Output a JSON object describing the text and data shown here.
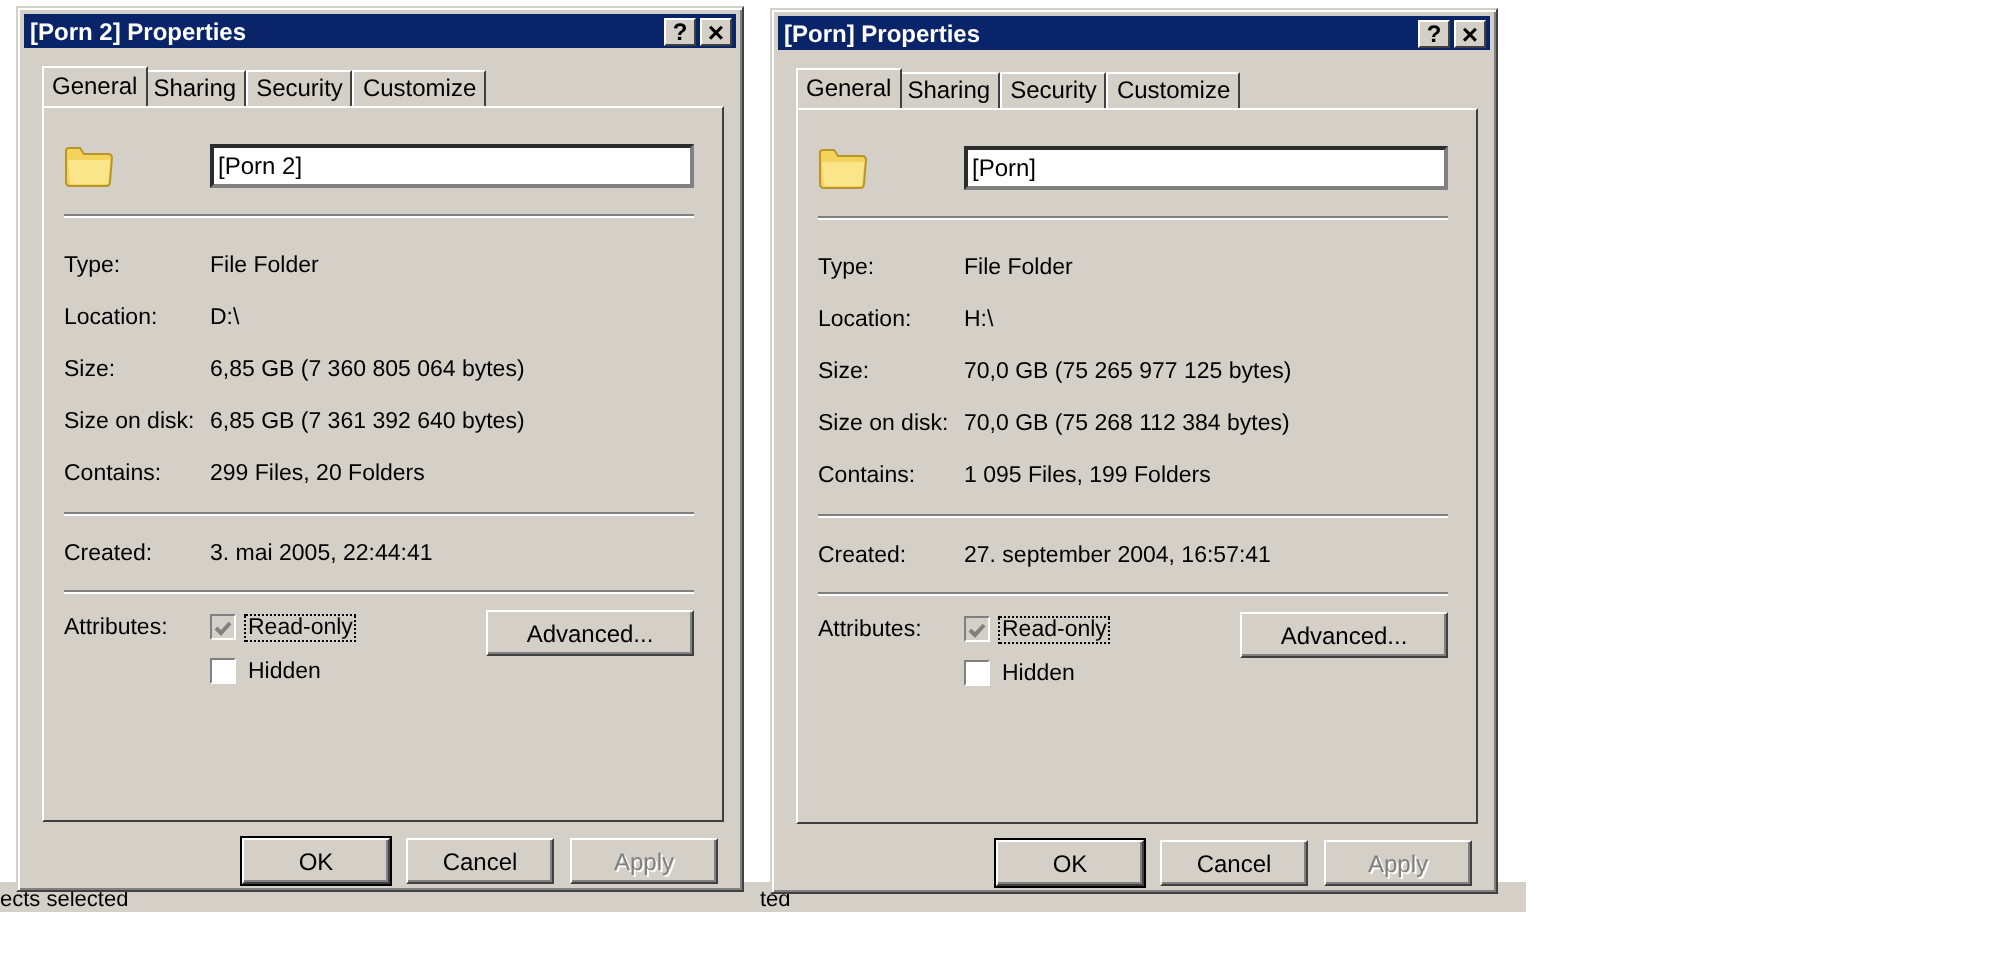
{
  "background": {
    "status_texts": [
      "ects selected",
      "ted"
    ]
  },
  "dialogs": [
    {
      "title": "[Porn 2] Properties",
      "title_buttons": [
        {
          "kind": "help",
          "label": "?"
        },
        {
          "kind": "close",
          "label": "×"
        }
      ],
      "tabs": [
        {
          "label": "General",
          "selected": true
        },
        {
          "label": "Sharing",
          "selected": false
        },
        {
          "label": "Security",
          "selected": false
        },
        {
          "label": "Customize",
          "selected": false
        }
      ],
      "name_field": {
        "value": "[Porn 2]"
      },
      "details": [
        {
          "label": "Type:",
          "value": "File Folder"
        },
        {
          "label": "Location:",
          "value": "D:\\"
        },
        {
          "label": "Size:",
          "value": "6,85 GB (7 360 805 064 bytes)"
        },
        {
          "label": "Size on disk:",
          "value": "6,85 GB (7 361 392 640 bytes)"
        },
        {
          "label": "Contains:",
          "value": "299 Files, 20 Folders"
        }
      ],
      "created": {
        "label": "Created:",
        "value": "3. mai 2005, 22:44:41"
      },
      "attributes": {
        "label": "Attributes:",
        "options": [
          {
            "label": "Read-only",
            "checked": true,
            "disabled": true,
            "focused": true
          },
          {
            "label": "Hidden",
            "checked": false,
            "disabled": false,
            "focused": false
          }
        ],
        "advanced_button": "Advanced..."
      },
      "buttons": [
        {
          "label": "OK",
          "default": true,
          "disabled": false
        },
        {
          "label": "Cancel",
          "default": false,
          "disabled": false
        },
        {
          "label": "Apply",
          "default": false,
          "disabled": true
        }
      ]
    },
    {
      "title": "[Porn] Properties",
      "title_buttons": [
        {
          "kind": "help",
          "label": "?"
        },
        {
          "kind": "close",
          "label": "×"
        }
      ],
      "tabs": [
        {
          "label": "General",
          "selected": true
        },
        {
          "label": "Sharing",
          "selected": false
        },
        {
          "label": "Security",
          "selected": false
        },
        {
          "label": "Customize",
          "selected": false
        }
      ],
      "name_field": {
        "value": "[Porn]"
      },
      "details": [
        {
          "label": "Type:",
          "value": "File Folder"
        },
        {
          "label": "Location:",
          "value": "H:\\"
        },
        {
          "label": "Size:",
          "value": "70,0 GB (75 265 977 125 bytes)"
        },
        {
          "label": "Size on disk:",
          "value": "70,0 GB (75 268 112 384 bytes)"
        },
        {
          "label": "Contains:",
          "value": "1 095 Files, 199 Folders"
        }
      ],
      "created": {
        "label": "Created:",
        "value": "27. september 2004, 16:57:41"
      },
      "attributes": {
        "label": "Attributes:",
        "options": [
          {
            "label": "Read-only",
            "checked": true,
            "disabled": true,
            "focused": true
          },
          {
            "label": "Hidden",
            "checked": false,
            "disabled": false,
            "focused": false
          }
        ],
        "advanced_button": "Advanced..."
      },
      "buttons": [
        {
          "label": "OK",
          "default": true,
          "disabled": false
        },
        {
          "label": "Cancel",
          "default": false,
          "disabled": false
        },
        {
          "label": "Apply",
          "default": false,
          "disabled": true
        }
      ]
    }
  ]
}
